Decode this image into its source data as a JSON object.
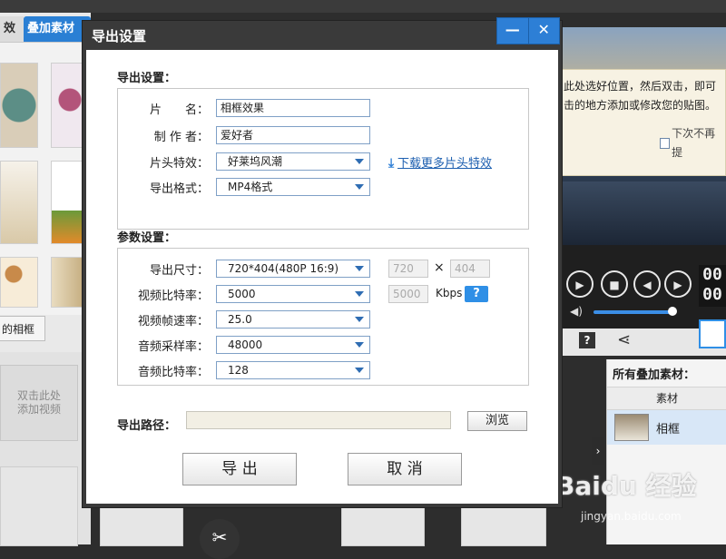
{
  "background_app": {
    "tabs": {
      "effects_tab": "效",
      "overlay_tab": "叠加素材"
    },
    "frame_label": "的相框",
    "add_video": {
      "line1": "双击此处",
      "line2": "添加视频"
    },
    "preview_tip": {
      "line1": "此处选好位置，然后双击，即可",
      "line2": "击的地方添加或修改您的贴图。",
      "checkbox_label": "下次不再提"
    },
    "timecode": {
      "line1": "00",
      "line2": "00"
    },
    "overlay_panel": {
      "title": "所有叠加素材：",
      "column_header": "素材",
      "items": [
        {
          "name": "相框"
        }
      ]
    },
    "watermark": {
      "main": "Baidu 经验",
      "sub": "jingyan.baidu.com"
    }
  },
  "dialog": {
    "title": "导出设置",
    "window_buttons": {
      "minimize": "—",
      "close": "✕"
    },
    "export_section": {
      "title": "导出设置：",
      "fields": {
        "title_label": "片　　名：",
        "title_value": "相框效果",
        "author_label": "制 作 者：",
        "author_value": "爱好者",
        "intro_label": "片头特效：",
        "intro_value": "好莱坞风潮",
        "format_label": "导出格式：",
        "format_value": "MP4格式"
      },
      "download_link": "下载更多片头特效"
    },
    "params_section": {
      "title": "参数设置：",
      "rows": [
        {
          "label": "导出尺寸：",
          "value": "720*404(480P 16:9)"
        },
        {
          "label": "视频比特率：",
          "value": "5000"
        },
        {
          "label": "视频帧速率：",
          "value": "25.0"
        },
        {
          "label": "音频采样率：",
          "value": "48000"
        },
        {
          "label": "音频比特率：",
          "value": "128"
        }
      ],
      "width_value": "720",
      "times_sign": "×",
      "height_value": "404",
      "bitrate_value": "5000",
      "bitrate_unit": "Kbps",
      "help_label": "?"
    },
    "path_section": {
      "label": "导出路径：",
      "value": "",
      "browse_button": "浏览"
    },
    "actions": {
      "export_button": "导 出",
      "cancel_button": "取 消"
    }
  }
}
